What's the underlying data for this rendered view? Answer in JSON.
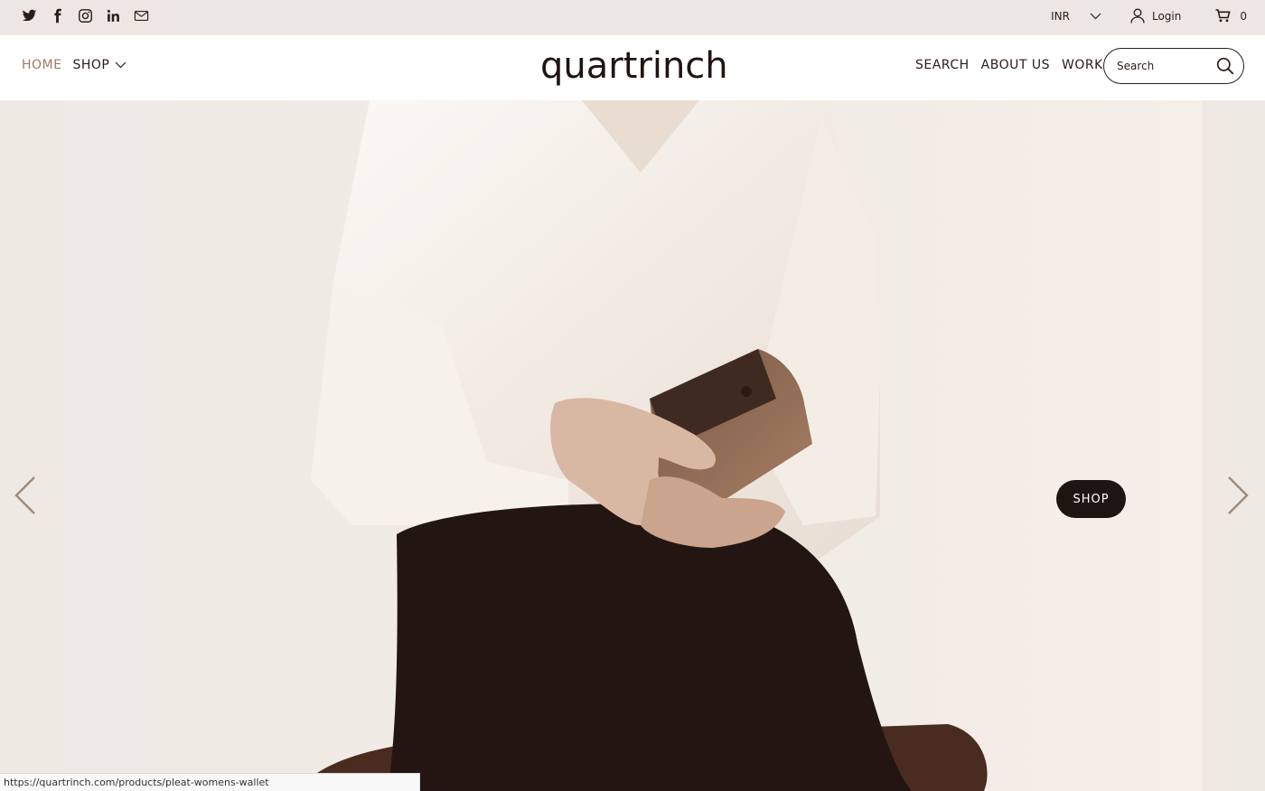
{
  "topbar": {
    "social": [
      {
        "icon": "twitter-icon"
      },
      {
        "icon": "facebook-icon"
      },
      {
        "icon": "instagram-icon"
      },
      {
        "icon": "linkedin-icon"
      },
      {
        "icon": "mail-icon"
      }
    ],
    "currency": "INR",
    "login_label": "Login",
    "cart_count": "0"
  },
  "header": {
    "nav_left": {
      "home": "HOME",
      "shop": "SHOP"
    },
    "logo_text": "quartrinch",
    "nav_right": {
      "search": "SEARCH",
      "about": "ABOUT US",
      "work": "WORK"
    },
    "search_placeholder": "Search"
  },
  "hero": {
    "shop_button": "SHOP"
  },
  "status_url": "https://quartrinch.com/products/pleat-womens-wallet",
  "colors": {
    "accent": "#9c7a63",
    "dark": "#1e1512",
    "topbar_bg": "#ece7e3"
  }
}
